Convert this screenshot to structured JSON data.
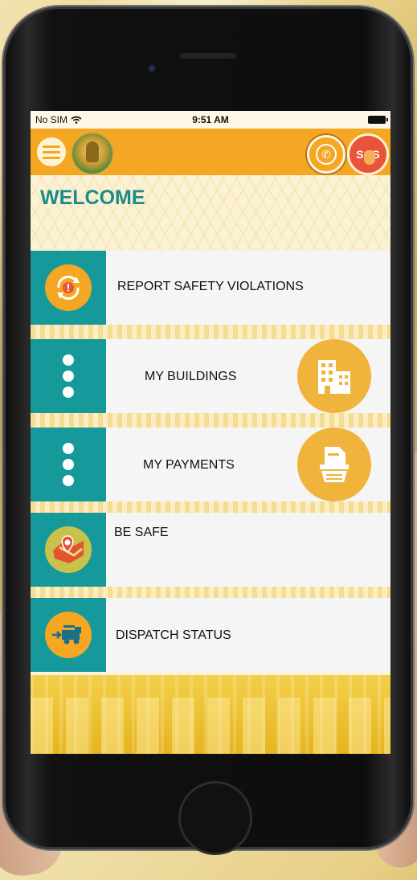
{
  "status_bar": {
    "carrier": "No SIM",
    "time": "9:51 AM"
  },
  "header": {
    "menu_icon": "hamburger-icon",
    "phone_icon": "phone-icon",
    "sos_label": "SOS"
  },
  "welcome": {
    "title": "WELCOME"
  },
  "menu": [
    {
      "label": "REPORT SAFETY VIOLATIONS",
      "icon": "warning-refresh-icon"
    },
    {
      "label": "MY BUILDINGS",
      "icon": "building-icon"
    },
    {
      "label": "MY PAYMENTS",
      "icon": "invoice-icon"
    },
    {
      "label": "BE SAFE",
      "icon": "map-pin-icon"
    },
    {
      "label": "DISPATCH STATUS",
      "icon": "fire-truck-icon"
    }
  ],
  "colors": {
    "accent": "#f5a623",
    "teal": "#16999a",
    "sos": "#e8533a",
    "title": "#1b8c8a"
  }
}
